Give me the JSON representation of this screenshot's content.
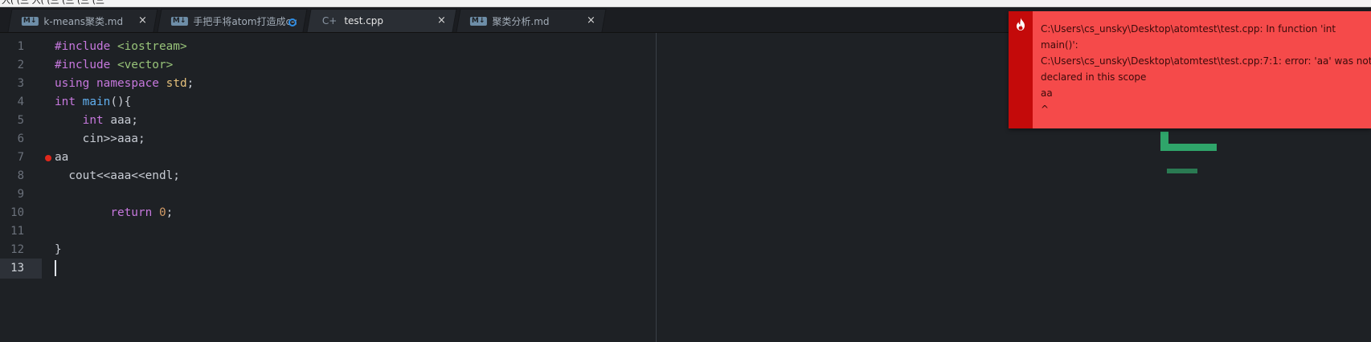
{
  "app": {
    "menubar_stub": [
      "入(",
      "(三",
      "入(",
      "(三",
      "(三",
      "(三",
      "(三"
    ]
  },
  "tabs": [
    {
      "icon": "M↓",
      "title": "k-means聚类.md",
      "status": "close"
    },
    {
      "icon": "M↓",
      "title": "手把手将atom打造成c-c...",
      "status": "modified"
    },
    {
      "icon": "C+",
      "title": "test.cpp",
      "status": "close",
      "active": true
    },
    {
      "icon": "M↓",
      "title": "聚类分析.md",
      "status": "close"
    }
  ],
  "tab_close_glyph": "×",
  "editor": {
    "line_numbers": [
      "1",
      "2",
      "3",
      "4",
      "5",
      "6",
      "7",
      "8",
      "9",
      "10",
      "11",
      "12",
      "13"
    ],
    "current_line": 13,
    "error_line": 7,
    "lines": [
      {
        "segments": [
          {
            "t": "#include",
            "c": "kw"
          },
          {
            "t": " "
          },
          {
            "t": "<iostream>",
            "c": "str"
          }
        ]
      },
      {
        "segments": [
          {
            "t": "#include",
            "c": "kw"
          },
          {
            "t": " "
          },
          {
            "t": "<vector>",
            "c": "str"
          }
        ]
      },
      {
        "segments": [
          {
            "t": "using",
            "c": "kw"
          },
          {
            "t": " "
          },
          {
            "t": "namespace",
            "c": "kw"
          },
          {
            "t": " "
          },
          {
            "t": "std",
            "c": "ns"
          },
          {
            "t": ";"
          }
        ]
      },
      {
        "segments": [
          {
            "t": "int",
            "c": "kw"
          },
          {
            "t": " "
          },
          {
            "t": "main",
            "c": "fn"
          },
          {
            "t": "(){"
          }
        ]
      },
      {
        "segments": [
          {
            "t": "    "
          },
          {
            "t": "int",
            "c": "kw"
          },
          {
            "t": " aaa;"
          }
        ]
      },
      {
        "segments": [
          {
            "t": "    cin>>aaa;"
          }
        ]
      },
      {
        "segments": [
          {
            "t": "aa"
          }
        ]
      },
      {
        "segments": [
          {
            "t": "  cout<<aaa<<endl;"
          }
        ]
      },
      {
        "segments": [
          {
            "t": ""
          }
        ]
      },
      {
        "segments": [
          {
            "t": "        "
          },
          {
            "t": "return",
            "c": "kw"
          },
          {
            "t": " "
          },
          {
            "t": "0",
            "c": "num"
          },
          {
            "t": ";"
          }
        ]
      },
      {
        "segments": [
          {
            "t": ""
          }
        ]
      },
      {
        "segments": [
          {
            "t": "}"
          }
        ]
      },
      {
        "segments": [
          {
            "t": ""
          }
        ]
      }
    ]
  },
  "notification": {
    "type": "error",
    "icon": "flame-icon",
    "lines": [
      "C:\\Users\\cs_unsky\\Desktop\\atomtest\\test.cpp: In function 'int",
      "main()':",
      "C:\\Users\\cs_unsky\\Desktop\\atomtest\\test.cpp:7:1: error: 'aa' was not",
      "declared in this scope",
      "aa",
      "^"
    ],
    "colors": {
      "background": "#f54a4a",
      "strip": "#c40a0a"
    }
  },
  "colors": {
    "editor_bg": "#1e2125",
    "keyword": "#c678dd",
    "string": "#98c379",
    "function": "#61afef",
    "namespace": "#e5c07b",
    "number": "#d19a66",
    "minimap_accent": "#2fa56a"
  }
}
